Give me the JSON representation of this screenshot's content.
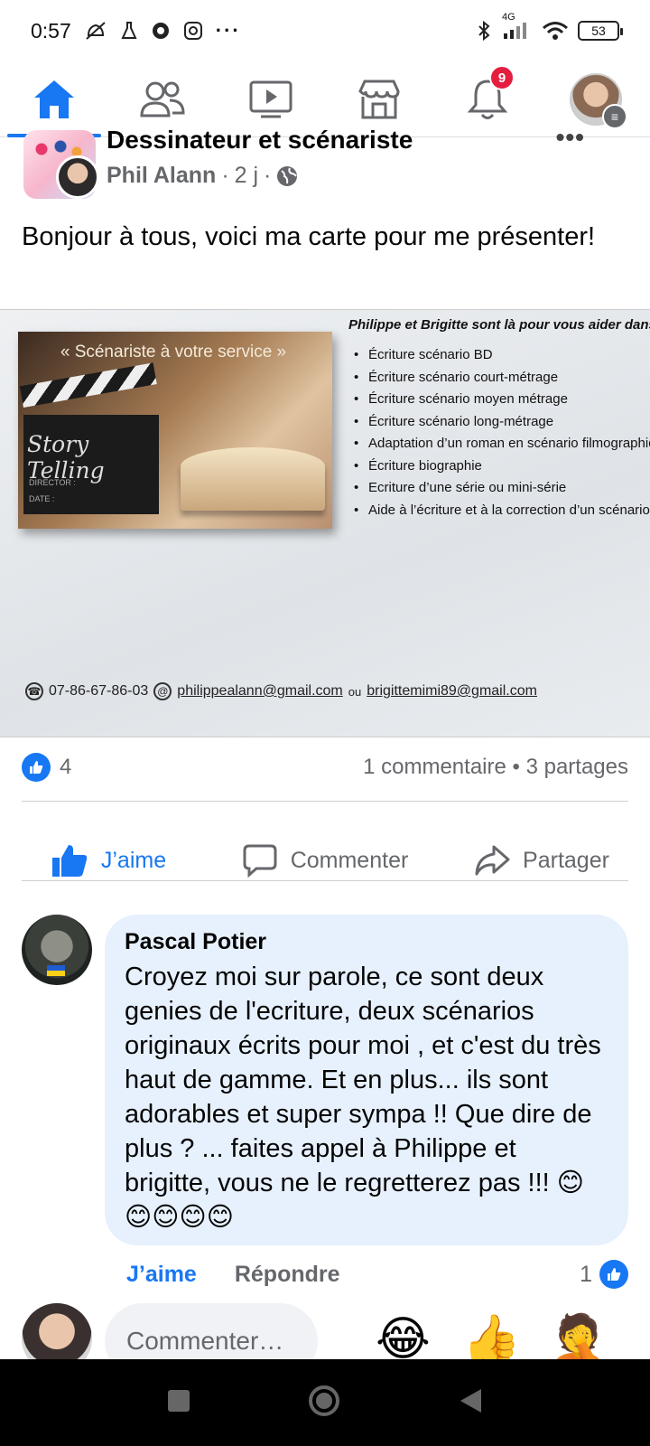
{
  "status_bar": {
    "time": "0:57",
    "network": "4G",
    "battery": "53"
  },
  "nav": {
    "tabs": [
      {
        "name": "home-tab",
        "icon": "home-icon",
        "active": true
      },
      {
        "name": "friends-tab",
        "icon": "friends-icon"
      },
      {
        "name": "watch-tab",
        "icon": "video-icon"
      },
      {
        "name": "marketplace-tab",
        "icon": "shop-icon"
      },
      {
        "name": "notifications-tab",
        "icon": "bell-icon"
      },
      {
        "name": "menu-tab",
        "icon": "profile-avatar"
      }
    ],
    "notification_count": "9"
  },
  "colors": {
    "accent": "#1877f2",
    "badge": "#e41e3f",
    "comment_bubble": "#e7f1fd"
  },
  "post": {
    "page_name": "Dessinateur et scénariste",
    "author": "Phil Alann",
    "time": "2 j",
    "separator": "·",
    "privacy_icon": "globe-icon",
    "more": "•••",
    "text": "Bonjour à tous, voici ma carte pour me présenter!",
    "card": {
      "slogan": "« Scénariste à votre service »",
      "clapper_text": "Story Telling",
      "clapper_director": "DIRECTOR :",
      "clapper_date": "DATE :",
      "heading": "Philippe et Brigitte sont là pour vous aider dans:",
      "services": [
        "Écriture scénario BD",
        "Écriture scénario court-métrage",
        "Écriture scénario moyen métrage",
        "Écriture scénario long-métrage",
        "Adaptation d’un roman en scénario filmographique",
        "Écriture biographie",
        "Ecriture d’une série ou mini-série",
        "Aide à l’écriture et à la correction d’un scénario"
      ],
      "phone": "07-86-67-86-03",
      "email1": "philippealann@gmail.com",
      "or": "ou",
      "email2": "brigittemimi89@gmail.com"
    },
    "reaction_count": "4",
    "comments_shares": "1 commentaire • 3 partages",
    "actions": {
      "like": "J’aime",
      "comment": "Commenter",
      "share": "Partager"
    }
  },
  "comment": {
    "author": "Pascal Potier",
    "text": "Croyez moi sur parole, ce sont deux genies de l'ecriture, deux scénarios originaux écrits pour moi , et c'est du très haut de gamme. Et en plus... ils sont adorables et super sympa !! Que dire de plus ? ... faites appel à Philippe et brigitte, vous ne le regretterez pas !!! 😊😊😊😊😊",
    "like": "J’aime",
    "reply": "Répondre",
    "reaction_count": "1"
  },
  "composer": {
    "placeholder": "Commenter…",
    "quick_reactions": [
      "😂",
      "👍",
      "🤦"
    ]
  }
}
